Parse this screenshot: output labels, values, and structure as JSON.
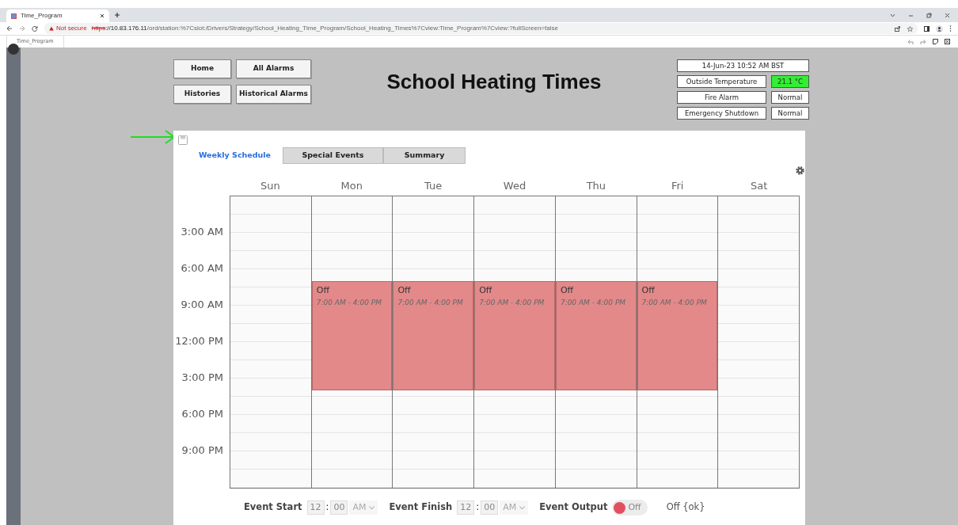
{
  "browser": {
    "tab_title": "Time_Program",
    "security": "Not secure",
    "url_scheme": "https",
    "url_host": "://10.83.176.11",
    "url_path": "/ord/station:%7Cslot:/Drivers/Strategy/School_Heating_Time_Program/School_Heating_Times%7Cview:Time_Program%7Cview:?fullScreen=false"
  },
  "app_tab": "Time_Program",
  "nav_buttons": [
    "Home",
    "All Alarms",
    "Histories",
    "Historical Alarms"
  ],
  "title": "School Heating Times",
  "status_panel": {
    "datetime": "14-Jun-23 10:52 AM BST",
    "points": [
      {
        "label": "Outside Temperature",
        "value": "21.1 °C",
        "color": "#33ee33"
      },
      {
        "label": "Fire Alarm",
        "value": "Normal",
        "color": "#ffffff"
      },
      {
        "label": "Emergency Shutdown",
        "value": "Normal",
        "color": "#ffffff"
      }
    ]
  },
  "tabs": [
    {
      "label": "Weekly Schedule",
      "selected": true
    },
    {
      "label": "Special Events",
      "selected": false
    },
    {
      "label": "Summary",
      "selected": false
    }
  ],
  "schedule": {
    "time_labels": [
      "3:00 AM",
      "6:00 AM",
      "9:00 AM",
      "12:00 PM",
      "3:00 PM",
      "6:00 PM",
      "9:00 PM"
    ],
    "days": [
      {
        "name": "Sun"
      },
      {
        "name": "Mon",
        "events": [
          {
            "title": "Off",
            "time": "7:00 AM - 4:00 PM"
          }
        ]
      },
      {
        "name": "Tue",
        "events": [
          {
            "title": "Off",
            "time": "7:00 AM - 4:00 PM"
          }
        ]
      },
      {
        "name": "Wed",
        "events": [
          {
            "title": "Off",
            "time": "7:00 AM - 4:00 PM"
          }
        ]
      },
      {
        "name": "Thu",
        "events": [
          {
            "title": "Off",
            "time": "7:00 AM - 4:00 PM"
          }
        ]
      },
      {
        "name": "Fri",
        "events": [
          {
            "title": "Off",
            "time": "7:00 AM - 4:00 PM"
          }
        ]
      },
      {
        "name": "Sat"
      }
    ]
  },
  "footer": {
    "event_start": {
      "label": "Event Start",
      "hour": "12",
      "separator": ":",
      "minute": "00",
      "ampm": "AM"
    },
    "event_finish": {
      "label": "Event Finish",
      "hour": "12",
      "separator": ":",
      "minute": "00",
      "ampm": "AM"
    },
    "event_output": {
      "label": "Event Output",
      "value": "Off",
      "on": false
    },
    "status": "Off {ok}"
  }
}
